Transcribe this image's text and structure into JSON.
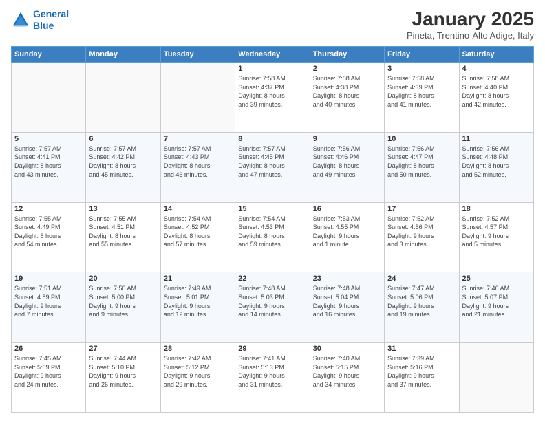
{
  "header": {
    "logo_line1": "General",
    "logo_line2": "Blue",
    "month": "January 2025",
    "location": "Pineta, Trentino-Alto Adige, Italy"
  },
  "weekdays": [
    "Sunday",
    "Monday",
    "Tuesday",
    "Wednesday",
    "Thursday",
    "Friday",
    "Saturday"
  ],
  "weeks": [
    [
      {
        "day": "",
        "info": ""
      },
      {
        "day": "",
        "info": ""
      },
      {
        "day": "",
        "info": ""
      },
      {
        "day": "1",
        "info": "Sunrise: 7:58 AM\nSunset: 4:37 PM\nDaylight: 8 hours\nand 39 minutes."
      },
      {
        "day": "2",
        "info": "Sunrise: 7:58 AM\nSunset: 4:38 PM\nDaylight: 8 hours\nand 40 minutes."
      },
      {
        "day": "3",
        "info": "Sunrise: 7:58 AM\nSunset: 4:39 PM\nDaylight: 8 hours\nand 41 minutes."
      },
      {
        "day": "4",
        "info": "Sunrise: 7:58 AM\nSunset: 4:40 PM\nDaylight: 8 hours\nand 42 minutes."
      }
    ],
    [
      {
        "day": "5",
        "info": "Sunrise: 7:57 AM\nSunset: 4:41 PM\nDaylight: 8 hours\nand 43 minutes."
      },
      {
        "day": "6",
        "info": "Sunrise: 7:57 AM\nSunset: 4:42 PM\nDaylight: 8 hours\nand 45 minutes."
      },
      {
        "day": "7",
        "info": "Sunrise: 7:57 AM\nSunset: 4:43 PM\nDaylight: 8 hours\nand 46 minutes."
      },
      {
        "day": "8",
        "info": "Sunrise: 7:57 AM\nSunset: 4:45 PM\nDaylight: 8 hours\nand 47 minutes."
      },
      {
        "day": "9",
        "info": "Sunrise: 7:56 AM\nSunset: 4:46 PM\nDaylight: 8 hours\nand 49 minutes."
      },
      {
        "day": "10",
        "info": "Sunrise: 7:56 AM\nSunset: 4:47 PM\nDaylight: 8 hours\nand 50 minutes."
      },
      {
        "day": "11",
        "info": "Sunrise: 7:56 AM\nSunset: 4:48 PM\nDaylight: 8 hours\nand 52 minutes."
      }
    ],
    [
      {
        "day": "12",
        "info": "Sunrise: 7:55 AM\nSunset: 4:49 PM\nDaylight: 8 hours\nand 54 minutes."
      },
      {
        "day": "13",
        "info": "Sunrise: 7:55 AM\nSunset: 4:51 PM\nDaylight: 8 hours\nand 55 minutes."
      },
      {
        "day": "14",
        "info": "Sunrise: 7:54 AM\nSunset: 4:52 PM\nDaylight: 8 hours\nand 57 minutes."
      },
      {
        "day": "15",
        "info": "Sunrise: 7:54 AM\nSunset: 4:53 PM\nDaylight: 8 hours\nand 59 minutes."
      },
      {
        "day": "16",
        "info": "Sunrise: 7:53 AM\nSunset: 4:55 PM\nDaylight: 9 hours\nand 1 minute."
      },
      {
        "day": "17",
        "info": "Sunrise: 7:52 AM\nSunset: 4:56 PM\nDaylight: 9 hours\nand 3 minutes."
      },
      {
        "day": "18",
        "info": "Sunrise: 7:52 AM\nSunset: 4:57 PM\nDaylight: 9 hours\nand 5 minutes."
      }
    ],
    [
      {
        "day": "19",
        "info": "Sunrise: 7:51 AM\nSunset: 4:59 PM\nDaylight: 9 hours\nand 7 minutes."
      },
      {
        "day": "20",
        "info": "Sunrise: 7:50 AM\nSunset: 5:00 PM\nDaylight: 9 hours\nand 9 minutes."
      },
      {
        "day": "21",
        "info": "Sunrise: 7:49 AM\nSunset: 5:01 PM\nDaylight: 9 hours\nand 12 minutes."
      },
      {
        "day": "22",
        "info": "Sunrise: 7:48 AM\nSunset: 5:03 PM\nDaylight: 9 hours\nand 14 minutes."
      },
      {
        "day": "23",
        "info": "Sunrise: 7:48 AM\nSunset: 5:04 PM\nDaylight: 9 hours\nand 16 minutes."
      },
      {
        "day": "24",
        "info": "Sunrise: 7:47 AM\nSunset: 5:06 PM\nDaylight: 9 hours\nand 19 minutes."
      },
      {
        "day": "25",
        "info": "Sunrise: 7:46 AM\nSunset: 5:07 PM\nDaylight: 9 hours\nand 21 minutes."
      }
    ],
    [
      {
        "day": "26",
        "info": "Sunrise: 7:45 AM\nSunset: 5:09 PM\nDaylight: 9 hours\nand 24 minutes."
      },
      {
        "day": "27",
        "info": "Sunrise: 7:44 AM\nSunset: 5:10 PM\nDaylight: 9 hours\nand 26 minutes."
      },
      {
        "day": "28",
        "info": "Sunrise: 7:42 AM\nSunset: 5:12 PM\nDaylight: 9 hours\nand 29 minutes."
      },
      {
        "day": "29",
        "info": "Sunrise: 7:41 AM\nSunset: 5:13 PM\nDaylight: 9 hours\nand 31 minutes."
      },
      {
        "day": "30",
        "info": "Sunrise: 7:40 AM\nSunset: 5:15 PM\nDaylight: 9 hours\nand 34 minutes."
      },
      {
        "day": "31",
        "info": "Sunrise: 7:39 AM\nSunset: 5:16 PM\nDaylight: 9 hours\nand 37 minutes."
      },
      {
        "day": "",
        "info": ""
      }
    ]
  ]
}
